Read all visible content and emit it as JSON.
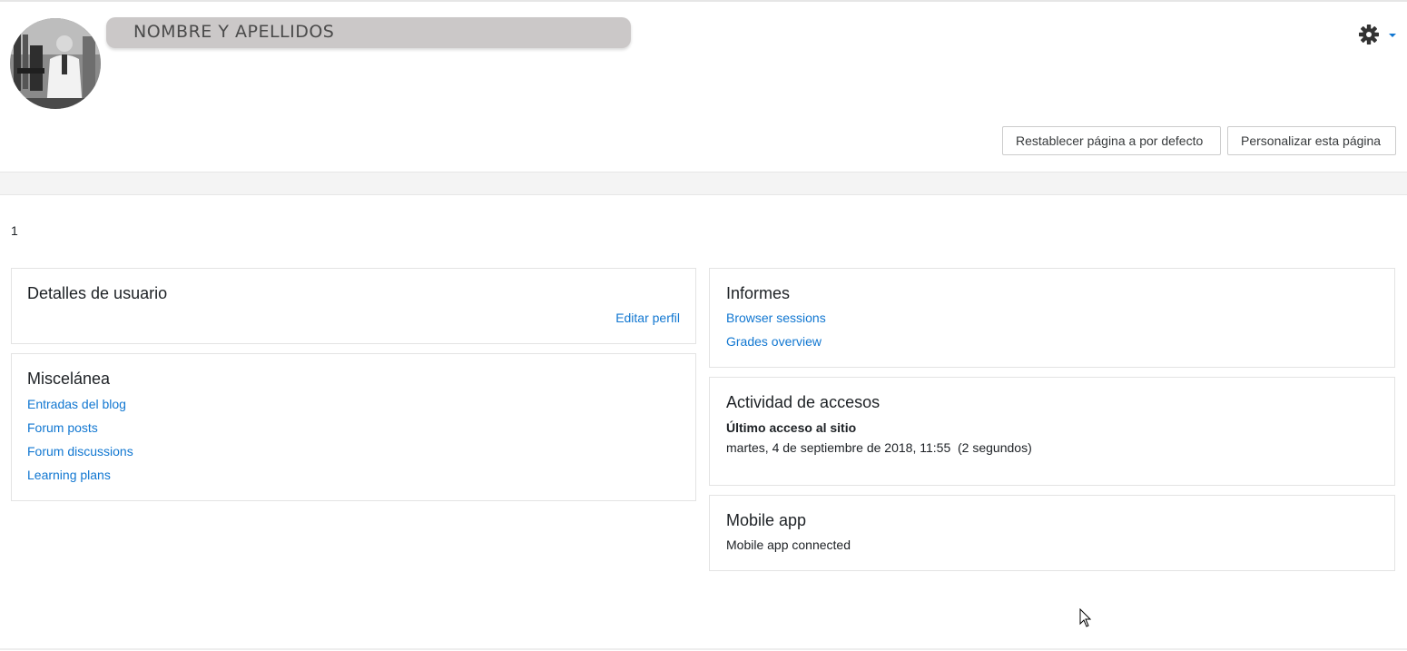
{
  "header": {
    "name": "NOMBRE Y APELLIDOS",
    "avatar_icon": "user-avatar-photo",
    "settings_icon": "gear-icon",
    "settings_caret_icon": "caret-down-icon",
    "reset_button": "Restablecer página a por defecto",
    "customize_button": "Personalizar esta página"
  },
  "page_number": "1",
  "user_details": {
    "title": "Detalles de usuario",
    "edit_link": "Editar perfil"
  },
  "misc": {
    "title": "Miscelánea",
    "links": [
      "Entradas del blog",
      "Forum posts",
      "Forum discussions",
      "Learning plans"
    ]
  },
  "reports": {
    "title": "Informes",
    "links": [
      "Browser sessions",
      "Grades overview"
    ]
  },
  "access": {
    "title": "Actividad de accesos",
    "last_access_label": "Último acceso al sitio",
    "last_access_value": "martes, 4 de septiembre de 2018, 11:55  (2 segundos)"
  },
  "mobile": {
    "title": "Mobile app",
    "status": "Mobile app connected"
  },
  "colors": {
    "link": "#1177d1",
    "name_bar": "#cbc8c8",
    "border": "#e3e3e3"
  }
}
